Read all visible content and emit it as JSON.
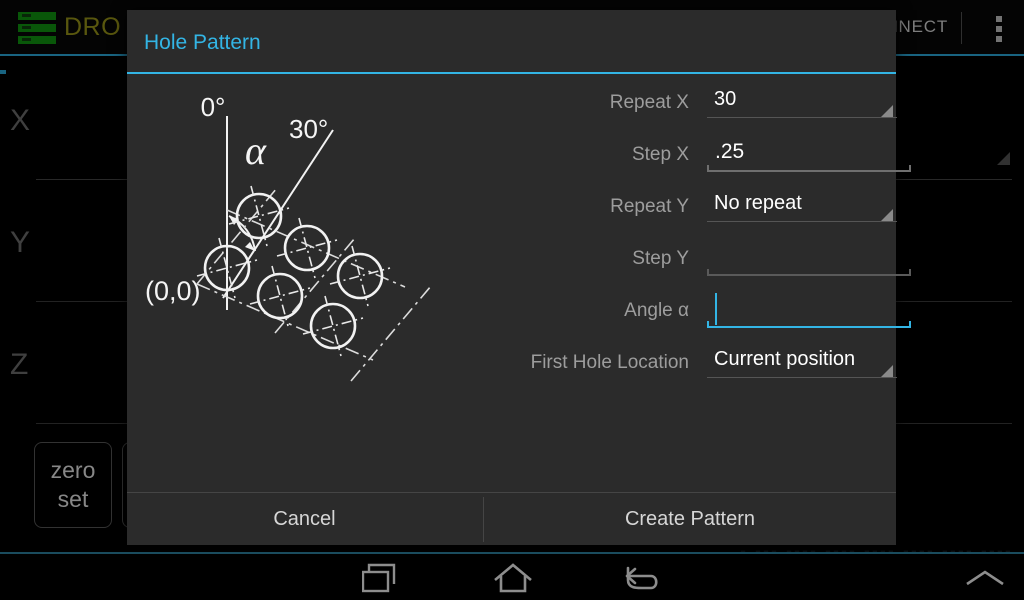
{
  "app": {
    "title": "DRO –",
    "logo_icon": "green-bars-logo",
    "connect_label": "ONNECT",
    "overflow_icon": "overflow-menu-icon",
    "axes": [
      {
        "label": "X",
        "value": ""
      },
      {
        "label": "Y",
        "value": ""
      },
      {
        "label": "Z",
        "value": ""
      }
    ],
    "strip_buttons": [
      {
        "label": "zero\nset",
        "line1": "zero",
        "line2": "set"
      },
      {
        "label": "",
        "line1": "",
        "line2": ""
      }
    ],
    "faint_readout": "- --- ---- ----       ----  ----  ----  ----"
  },
  "dialog": {
    "title": "Hole Pattern",
    "accent_color": "#33b5e5",
    "background_color": "#2b2b2b",
    "illustration": {
      "name": "hole-pattern-diagram",
      "labels": {
        "zero_deg": "0°",
        "thirty_deg": "30°",
        "alpha": "α",
        "origin": "(0,0)"
      }
    },
    "fields": [
      {
        "name": "repeat-x",
        "label": "Repeat X",
        "control": "spinner",
        "value": "30",
        "placeholder": ""
      },
      {
        "name": "step-x",
        "label": "Step X",
        "control": "edittext",
        "value": ".25",
        "placeholder": "",
        "focused": false
      },
      {
        "name": "repeat-y",
        "label": "Repeat Y",
        "control": "spinner",
        "value": "No repeat",
        "placeholder": ""
      },
      {
        "name": "step-y",
        "label": "Step Y",
        "control": "edittext",
        "value": "",
        "placeholder": "",
        "focused": false
      },
      {
        "name": "angle-alpha",
        "label": "Angle α",
        "control": "edittext",
        "value": "",
        "placeholder": "",
        "focused": true
      },
      {
        "name": "first-hole-location",
        "label": "First Hole Location",
        "control": "spinner",
        "value": "Current position",
        "placeholder": ""
      }
    ],
    "buttons": {
      "cancel": "Cancel",
      "create": "Create Pattern"
    }
  },
  "navbar": {
    "recents_icon": "recents-icon",
    "home_icon": "home-icon",
    "back_icon": "back-icon",
    "expand_icon": "chevron-up-icon"
  }
}
